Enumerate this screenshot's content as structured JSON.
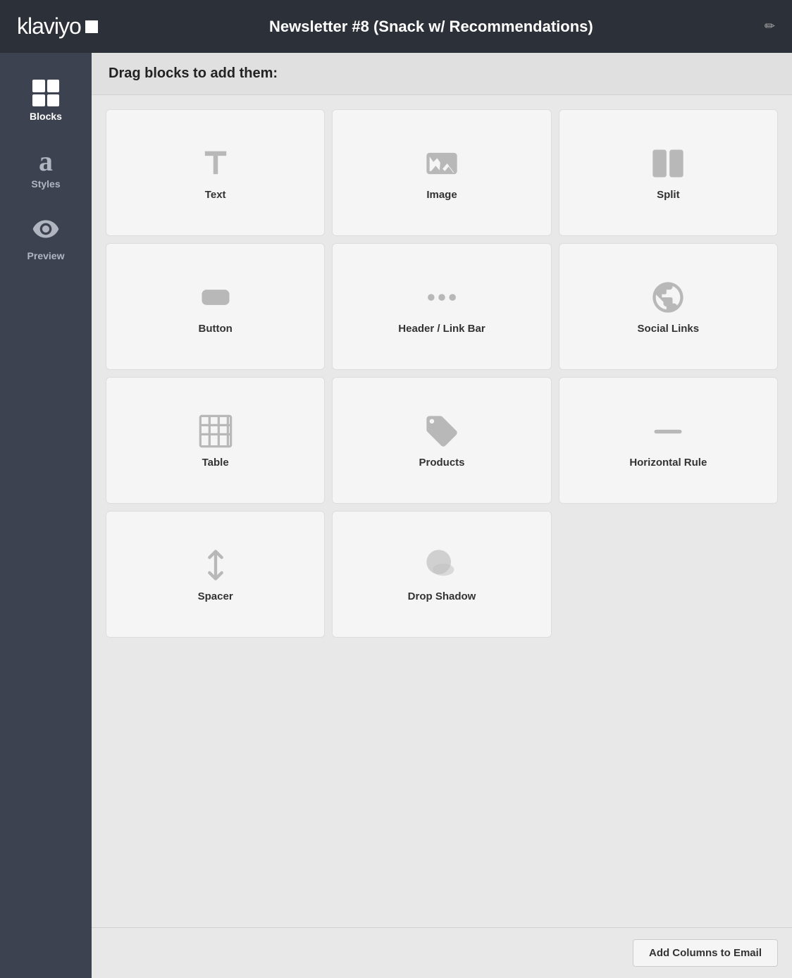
{
  "header": {
    "logo_text": "klaviyo",
    "title": "Newsletter #8 (Snack w/ Recommendations)",
    "edit_icon": "✏"
  },
  "sidebar": {
    "items": [
      {
        "id": "blocks",
        "label": "Blocks",
        "icon": "blocks",
        "active": true
      },
      {
        "id": "styles",
        "label": "Styles",
        "icon": "a",
        "active": false
      },
      {
        "id": "preview",
        "label": "Preview",
        "icon": "eye",
        "active": false
      }
    ]
  },
  "drag_header": "Drag blocks to add them:",
  "blocks": [
    {
      "id": "text",
      "label": "Text",
      "icon": "text"
    },
    {
      "id": "image",
      "label": "Image",
      "icon": "image"
    },
    {
      "id": "split",
      "label": "Split",
      "icon": "split"
    },
    {
      "id": "button",
      "label": "Button",
      "icon": "button"
    },
    {
      "id": "header-link-bar",
      "label": "Header / Link Bar",
      "icon": "header"
    },
    {
      "id": "social-links",
      "label": "Social Links",
      "icon": "social"
    },
    {
      "id": "table",
      "label": "Table",
      "icon": "table"
    },
    {
      "id": "products",
      "label": "Products",
      "icon": "products"
    },
    {
      "id": "horizontal-rule",
      "label": "Horizontal Rule",
      "icon": "rule"
    },
    {
      "id": "spacer",
      "label": "Spacer",
      "icon": "spacer"
    },
    {
      "id": "drop-shadow",
      "label": "Drop Shadow",
      "icon": "shadow"
    }
  ],
  "footer": {
    "add_columns_label": "Add Columns to Email"
  }
}
